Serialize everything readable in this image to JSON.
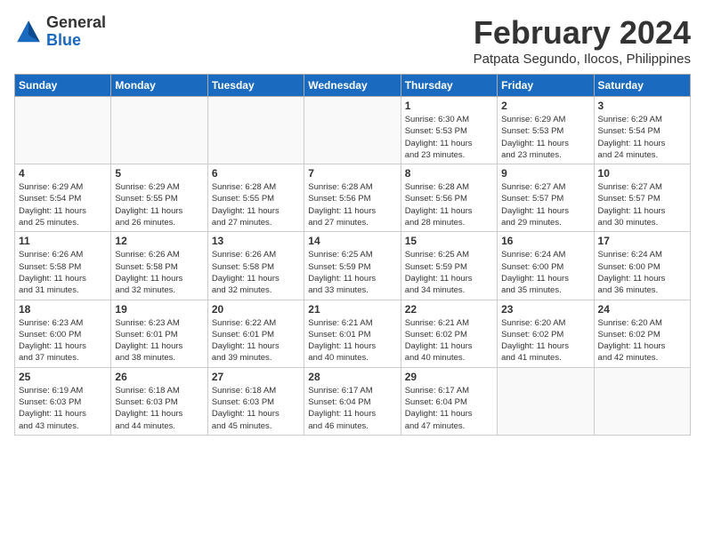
{
  "logo": {
    "general": "General",
    "blue": "Blue"
  },
  "title": {
    "month_year": "February 2024",
    "location": "Patpata Segundo, Ilocos, Philippines"
  },
  "days_of_week": [
    "Sunday",
    "Monday",
    "Tuesday",
    "Wednesday",
    "Thursday",
    "Friday",
    "Saturday"
  ],
  "weeks": [
    [
      {
        "day": "",
        "info": ""
      },
      {
        "day": "",
        "info": ""
      },
      {
        "day": "",
        "info": ""
      },
      {
        "day": "",
        "info": ""
      },
      {
        "day": "1",
        "info": "Sunrise: 6:30 AM\nSunset: 5:53 PM\nDaylight: 11 hours\nand 23 minutes."
      },
      {
        "day": "2",
        "info": "Sunrise: 6:29 AM\nSunset: 5:53 PM\nDaylight: 11 hours\nand 23 minutes."
      },
      {
        "day": "3",
        "info": "Sunrise: 6:29 AM\nSunset: 5:54 PM\nDaylight: 11 hours\nand 24 minutes."
      }
    ],
    [
      {
        "day": "4",
        "info": "Sunrise: 6:29 AM\nSunset: 5:54 PM\nDaylight: 11 hours\nand 25 minutes."
      },
      {
        "day": "5",
        "info": "Sunrise: 6:29 AM\nSunset: 5:55 PM\nDaylight: 11 hours\nand 26 minutes."
      },
      {
        "day": "6",
        "info": "Sunrise: 6:28 AM\nSunset: 5:55 PM\nDaylight: 11 hours\nand 27 minutes."
      },
      {
        "day": "7",
        "info": "Sunrise: 6:28 AM\nSunset: 5:56 PM\nDaylight: 11 hours\nand 27 minutes."
      },
      {
        "day": "8",
        "info": "Sunrise: 6:28 AM\nSunset: 5:56 PM\nDaylight: 11 hours\nand 28 minutes."
      },
      {
        "day": "9",
        "info": "Sunrise: 6:27 AM\nSunset: 5:57 PM\nDaylight: 11 hours\nand 29 minutes."
      },
      {
        "day": "10",
        "info": "Sunrise: 6:27 AM\nSunset: 5:57 PM\nDaylight: 11 hours\nand 30 minutes."
      }
    ],
    [
      {
        "day": "11",
        "info": "Sunrise: 6:26 AM\nSunset: 5:58 PM\nDaylight: 11 hours\nand 31 minutes."
      },
      {
        "day": "12",
        "info": "Sunrise: 6:26 AM\nSunset: 5:58 PM\nDaylight: 11 hours\nand 32 minutes."
      },
      {
        "day": "13",
        "info": "Sunrise: 6:26 AM\nSunset: 5:58 PM\nDaylight: 11 hours\nand 32 minutes."
      },
      {
        "day": "14",
        "info": "Sunrise: 6:25 AM\nSunset: 5:59 PM\nDaylight: 11 hours\nand 33 minutes."
      },
      {
        "day": "15",
        "info": "Sunrise: 6:25 AM\nSunset: 5:59 PM\nDaylight: 11 hours\nand 34 minutes."
      },
      {
        "day": "16",
        "info": "Sunrise: 6:24 AM\nSunset: 6:00 PM\nDaylight: 11 hours\nand 35 minutes."
      },
      {
        "day": "17",
        "info": "Sunrise: 6:24 AM\nSunset: 6:00 PM\nDaylight: 11 hours\nand 36 minutes."
      }
    ],
    [
      {
        "day": "18",
        "info": "Sunrise: 6:23 AM\nSunset: 6:00 PM\nDaylight: 11 hours\nand 37 minutes."
      },
      {
        "day": "19",
        "info": "Sunrise: 6:23 AM\nSunset: 6:01 PM\nDaylight: 11 hours\nand 38 minutes."
      },
      {
        "day": "20",
        "info": "Sunrise: 6:22 AM\nSunset: 6:01 PM\nDaylight: 11 hours\nand 39 minutes."
      },
      {
        "day": "21",
        "info": "Sunrise: 6:21 AM\nSunset: 6:01 PM\nDaylight: 11 hours\nand 40 minutes."
      },
      {
        "day": "22",
        "info": "Sunrise: 6:21 AM\nSunset: 6:02 PM\nDaylight: 11 hours\nand 40 minutes."
      },
      {
        "day": "23",
        "info": "Sunrise: 6:20 AM\nSunset: 6:02 PM\nDaylight: 11 hours\nand 41 minutes."
      },
      {
        "day": "24",
        "info": "Sunrise: 6:20 AM\nSunset: 6:02 PM\nDaylight: 11 hours\nand 42 minutes."
      }
    ],
    [
      {
        "day": "25",
        "info": "Sunrise: 6:19 AM\nSunset: 6:03 PM\nDaylight: 11 hours\nand 43 minutes."
      },
      {
        "day": "26",
        "info": "Sunrise: 6:18 AM\nSunset: 6:03 PM\nDaylight: 11 hours\nand 44 minutes."
      },
      {
        "day": "27",
        "info": "Sunrise: 6:18 AM\nSunset: 6:03 PM\nDaylight: 11 hours\nand 45 minutes."
      },
      {
        "day": "28",
        "info": "Sunrise: 6:17 AM\nSunset: 6:04 PM\nDaylight: 11 hours\nand 46 minutes."
      },
      {
        "day": "29",
        "info": "Sunrise: 6:17 AM\nSunset: 6:04 PM\nDaylight: 11 hours\nand 47 minutes."
      },
      {
        "day": "",
        "info": ""
      },
      {
        "day": "",
        "info": ""
      }
    ]
  ]
}
